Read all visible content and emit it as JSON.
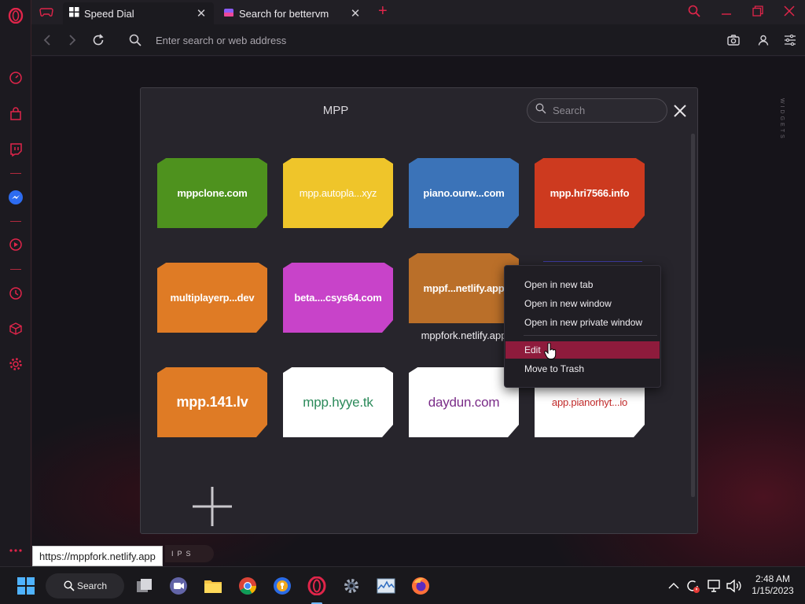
{
  "browser": {
    "tabs": [
      {
        "title": "Speed Dial",
        "active": true
      },
      {
        "title": "Search for bettervm",
        "active": false
      }
    ],
    "address_placeholder": "Enter search or web address"
  },
  "folder": {
    "title": "MPP",
    "search_placeholder": "Search",
    "tiles": [
      {
        "html_parts": [
          "mppclone",
          ".com"
        ],
        "label": "mppclone.com",
        "color": "#4e921e"
      },
      {
        "label": "mpp.autopla...xyz",
        "color": "#efc52a"
      },
      {
        "label": "piano.ourw...com",
        "color": "#3b73b8"
      },
      {
        "label": "mpp.hri7566.info",
        "color": "#cd3a1f"
      },
      {
        "label": "multiplayerp...dev",
        "color": "#df7b25"
      },
      {
        "label": "beta....csys64.com",
        "color": "#c843c9"
      },
      {
        "label": "mppf...netlify.app",
        "color": "#ba6f29",
        "caption": "mppfork.netlify.app"
      },
      {
        "label": "",
        "color": "#27252c"
      },
      {
        "label": "mpp.141.lv",
        "color": "#df7b25"
      },
      {
        "label": "mpp.hyye.tk",
        "color": "#ffffff",
        "text_color": "#2b8a5a"
      },
      {
        "label": "daydun.com",
        "color": "#ffffff",
        "text_color": "#7a2c88"
      },
      {
        "label": "app.pianorhyt...io",
        "color": "#ffffff",
        "text_color": "#c22a2a"
      }
    ]
  },
  "context_menu": {
    "items": [
      "Open in new tab",
      "Open in new window",
      "Open in new private window",
      "Edit",
      "Move to Trash"
    ],
    "highlighted": "Edit"
  },
  "status_url": "https://mppfork.netlify.app",
  "tips_label": "IPS",
  "widgets_label": "WIDGETS",
  "taskbar": {
    "search_label": "Search",
    "time": "2:48 AM",
    "date": "1/15/2023"
  },
  "colors": {
    "accent": "#e0254a",
    "menu_highlight": "#8e1b3c"
  }
}
